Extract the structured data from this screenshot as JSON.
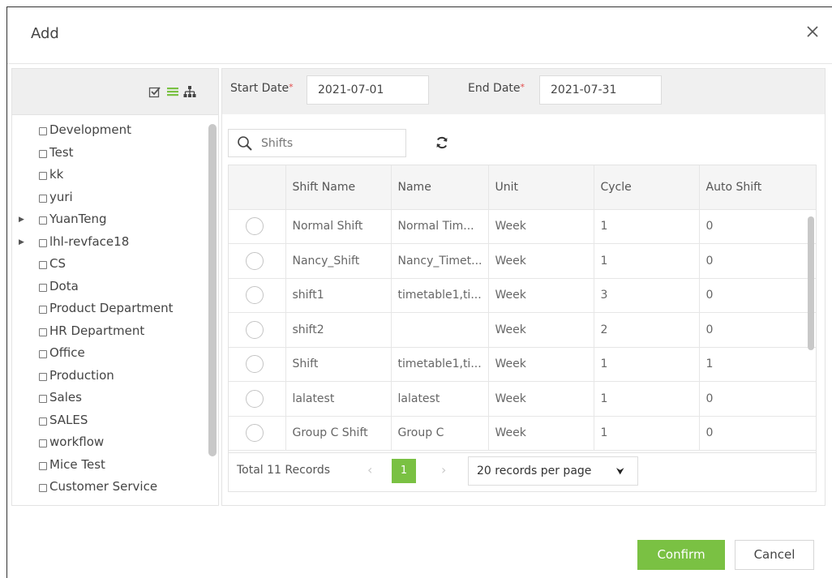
{
  "dialog": {
    "title": "Add"
  },
  "tree": {
    "items": [
      {
        "label": "Development",
        "expandable": false
      },
      {
        "label": "Test",
        "expandable": false
      },
      {
        "label": "kk",
        "expandable": false
      },
      {
        "label": "yuri",
        "expandable": false
      },
      {
        "label": "YuanTeng",
        "expandable": true
      },
      {
        "label": "lhl-revface18",
        "expandable": true
      },
      {
        "label": "CS",
        "expandable": false
      },
      {
        "label": "Dota",
        "expandable": false
      },
      {
        "label": "Product Department",
        "expandable": false
      },
      {
        "label": "HR Department",
        "expandable": false
      },
      {
        "label": "Office",
        "expandable": false
      },
      {
        "label": "Production",
        "expandable": false
      },
      {
        "label": "Sales",
        "expandable": false
      },
      {
        "label": "SALES",
        "expandable": false
      },
      {
        "label": "workflow",
        "expandable": false
      },
      {
        "label": "Mice Test",
        "expandable": false
      },
      {
        "label": "Customer Service",
        "expandable": false
      }
    ]
  },
  "filters": {
    "start_label": "Start Date",
    "start_value": "2021-07-01",
    "end_label": "End Date",
    "end_value": "2021-07-31",
    "required_mark": "*"
  },
  "search": {
    "placeholder": "Shifts"
  },
  "table": {
    "columns": [
      "",
      "Shift Name",
      "Name",
      "Unit",
      "Cycle",
      "Auto Shift"
    ],
    "rows": [
      [
        "Normal Shift",
        "Normal Tim...",
        "Week",
        "1",
        "0"
      ],
      [
        "Nancy_Shift",
        "Nancy_Timet...",
        "Week",
        "1",
        "0"
      ],
      [
        "shift1",
        "timetable1,ti...",
        "Week",
        "3",
        "0"
      ],
      [
        "shift2",
        "",
        "Week",
        "2",
        "0"
      ],
      [
        "Shift",
        "timetable1,ti...",
        "Week",
        "1",
        "1"
      ],
      [
        "lalatest",
        "lalatest",
        "Week",
        "1",
        "0"
      ],
      [
        "Group C Shift",
        "Group C",
        "Week",
        "1",
        "0"
      ]
    ]
  },
  "pagination": {
    "total": "Total 11 Records",
    "current_page": "1",
    "prev": "‹",
    "next": "›",
    "per_page": "20 records per page"
  },
  "buttons": {
    "confirm": "Confirm",
    "cancel": "Cancel"
  },
  "colors": {
    "accent": "#7ac143",
    "required": "#e34b4b"
  }
}
